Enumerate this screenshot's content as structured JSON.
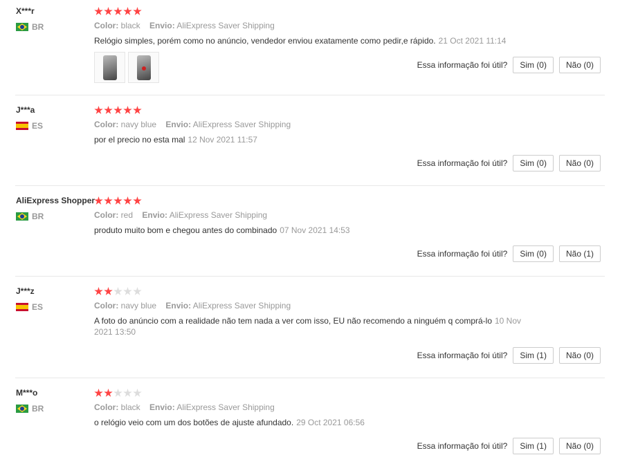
{
  "helpful_label": "Essa informação foi útil?",
  "reviews": [
    {
      "user": "X***r",
      "country": "BR",
      "color_label": "Color:",
      "color": "black",
      "shipping_label": "Envio:",
      "shipping": "AliExpress Saver Shipping",
      "text": "Relógio simples, porém como no anúncio, vendedor enviou exatamente como pedir,e rápido.",
      "date": "21 Oct 2021 11:14",
      "rating": 5,
      "yes": "Sim (0)",
      "no": "Não (0)"
    },
    {
      "user": "J***a",
      "country": "ES",
      "color_label": "Color:",
      "color": "navy blue",
      "shipping_label": "Envio:",
      "shipping": "AliExpress Saver Shipping",
      "text": "por el precio no esta mal",
      "date": "12 Nov 2021 11:57",
      "rating": 5,
      "yes": "Sim (0)",
      "no": "Não (0)"
    },
    {
      "user": "AliExpress Shopper",
      "country": "BR",
      "color_label": "Color:",
      "color": "red",
      "shipping_label": "Envio:",
      "shipping": "AliExpress Saver Shipping",
      "text": "produto muito bom e chegou antes do combinado",
      "date": "07 Nov 2021 14:53",
      "rating": 5,
      "yes": "Sim (0)",
      "no": "Não (1)"
    },
    {
      "user": "J***z",
      "country": "ES",
      "color_label": "Color:",
      "color": "navy blue",
      "shipping_label": "Envio:",
      "shipping": "AliExpress Saver Shipping",
      "text": "A foto do anúncio com a realidade não tem nada a ver com isso, EU não recomendo a ninguém q comprá-lo",
      "date": "10 Nov 2021 13:50",
      "rating": 2,
      "yes": "Sim (1)",
      "no": "Não (0)"
    },
    {
      "user": "M***o",
      "country": "BR",
      "color_label": "Color:",
      "color": "black",
      "shipping_label": "Envio:",
      "shipping": "AliExpress Saver Shipping",
      "text": "o relógio veio com um dos botões de ajuste afundado.",
      "date": "29 Oct 2021 06:56",
      "rating": 2,
      "yes": "Sim (1)",
      "no": "Não (0)"
    }
  ]
}
